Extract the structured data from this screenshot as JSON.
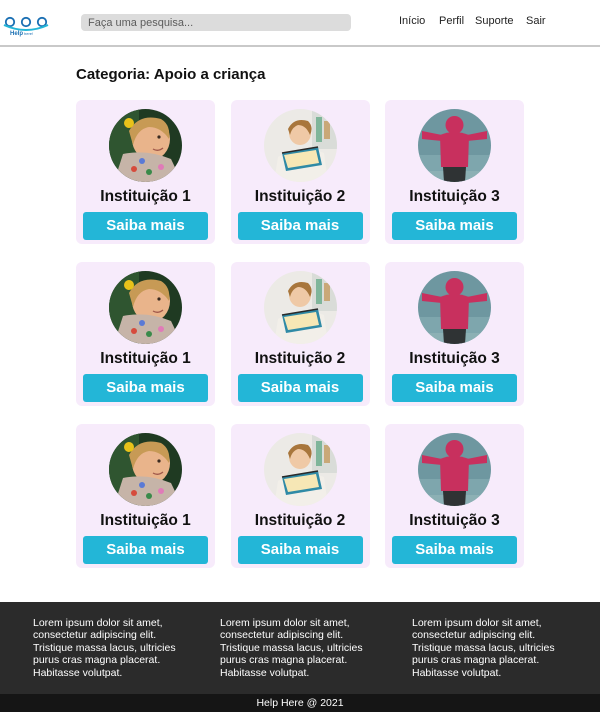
{
  "header": {
    "logo_text": "Help",
    "logo_subtext": "here!",
    "search_placeholder": "Faça uma pesquisa...",
    "nav": [
      "Início",
      "Perfil",
      "Suporte",
      "Sair"
    ]
  },
  "main": {
    "title": "Categoria: Apoio a criança",
    "cards": [
      {
        "name": "Instituição 1",
        "button": "Saiba mais",
        "image": "girl-portrait"
      },
      {
        "name": "Instituição 2",
        "button": "Saiba mais",
        "image": "child-reading"
      },
      {
        "name": "Instituição 3",
        "button": "Saiba mais",
        "image": "child-pink-hoodie"
      },
      {
        "name": "Instituição 1",
        "button": "Saiba mais",
        "image": "girl-portrait"
      },
      {
        "name": "Instituição 2",
        "button": "Saiba mais",
        "image": "child-reading"
      },
      {
        "name": "Instituição 3",
        "button": "Saiba mais",
        "image": "child-pink-hoodie"
      },
      {
        "name": "Instituição 1",
        "button": "Saiba mais",
        "image": "girl-portrait"
      },
      {
        "name": "Instituição 2",
        "button": "Saiba mais",
        "image": "child-reading"
      },
      {
        "name": "Instituição 3",
        "button": "Saiba mais",
        "image": "child-pink-hoodie"
      }
    ]
  },
  "footer": {
    "columns": [
      [
        "Lorem ipsum dolor sit amet,",
        "consectetur adipiscing elit.",
        "Tristique massa lacus, ultricies",
        "purus cras magna placerat.",
        "Habitasse volutpat."
      ],
      [
        "Lorem ipsum dolor sit amet,",
        "consectetur adipiscing elit.",
        "Tristique massa lacus, ultricies",
        "purus cras magna placerat.",
        "Habitasse volutpat."
      ],
      [
        "Lorem ipsum dolor sit amet,",
        "consectetur adipiscing elit.",
        "Tristique massa lacus, ultricies",
        "purus cras magna placerat.",
        "Habitasse volutpat."
      ]
    ],
    "copyright": "Help Here @ 2021"
  },
  "colors": {
    "accent": "#23b6d7",
    "card_background": "#f7ebfb",
    "footer_background": "#2b2b2b",
    "footer_bottom": "#151515"
  }
}
